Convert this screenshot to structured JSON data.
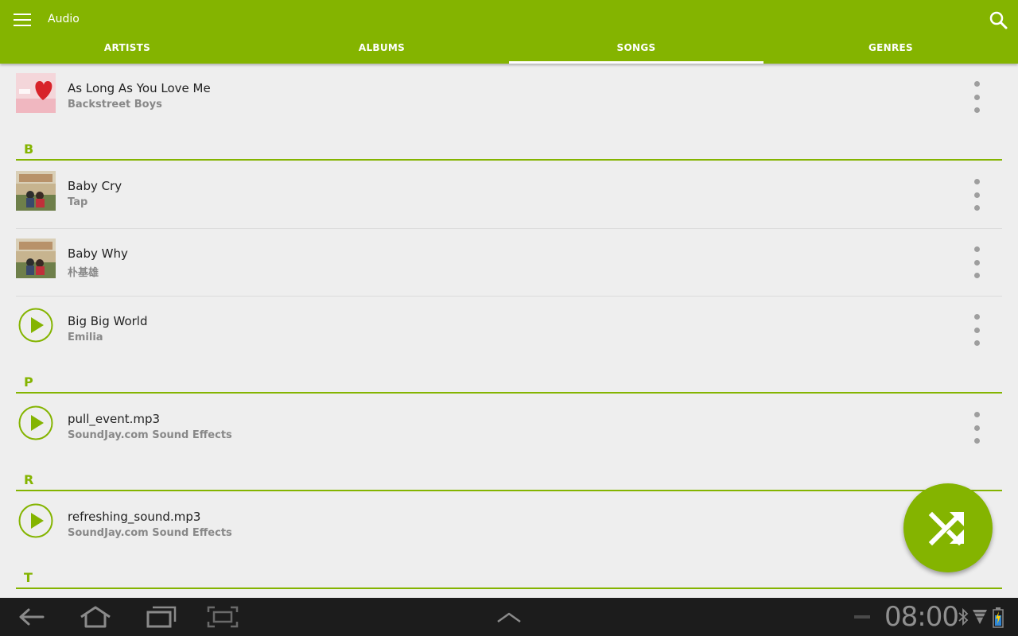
{
  "app": {
    "title": "Audio"
  },
  "tabs": [
    {
      "label": "ARTISTS"
    },
    {
      "label": "ALBUMS"
    },
    {
      "label": "SONGS"
    },
    {
      "label": "GENRES"
    }
  ],
  "active_tab": "SONGS",
  "songs": [
    {
      "title": "As Long As You Love Me",
      "artist": "Backstreet Boys"
    },
    {
      "title": "Baby Cry",
      "artist": "Tap"
    },
    {
      "title": "Baby Why",
      "artist": "朴基雄"
    },
    {
      "title": "Big Big World",
      "artist": "Emilia"
    },
    {
      "title": "pull_event.mp3",
      "artist": "SoundJay.com Sound Effects"
    },
    {
      "title": "refreshing_sound.mp3",
      "artist": "SoundJay.com Sound Effects"
    }
  ],
  "sections": [
    {
      "letter": "B"
    },
    {
      "letter": "P"
    },
    {
      "letter": "R"
    },
    {
      "letter": "T"
    }
  ],
  "status": {
    "time": "08:00"
  },
  "colors": {
    "accent": "#84b400",
    "background": "#eeeeee",
    "system_bar": "#1c1c1c"
  }
}
